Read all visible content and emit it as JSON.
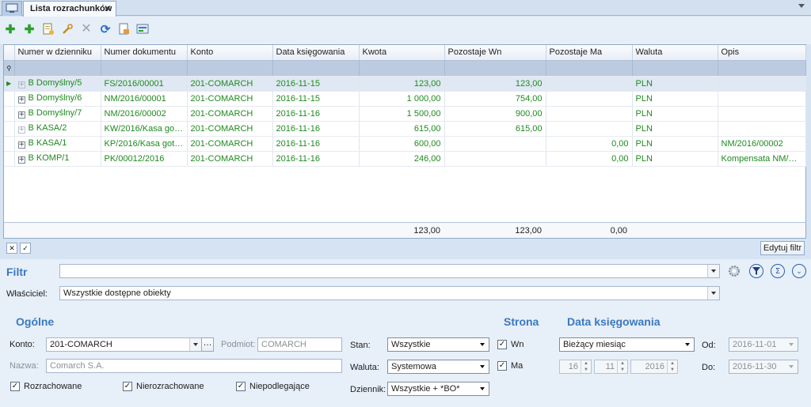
{
  "tabs": {
    "active_label": "Lista rozrachunków",
    "close_glyph": "✕"
  },
  "toolbar": {
    "icons": [
      "add-icon",
      "add-copy-icon",
      "add-document-icon",
      "edit-icon",
      "delete-icon",
      "refresh-icon",
      "export-icon",
      "settle-icon"
    ]
  },
  "grid": {
    "columns": [
      "Numer w dzienniku",
      "Numer dokumentu",
      "Konto",
      "Data księgowania",
      "Kwota",
      "Pozostaje Wn",
      "Pozostaje Ma",
      "Waluta",
      "Opis"
    ],
    "rows": [
      {
        "nr": "B Domyślny/5",
        "dok": "FS/2016/00001",
        "konto": "201-COMARCH",
        "data": "2016-11-15",
        "kwota": "123,00",
        "wn": "123,00",
        "ma": "",
        "waluta": "PLN",
        "opis": ""
      },
      {
        "nr": "B Domyślny/6",
        "dok": "NM/2016/00001",
        "konto": "201-COMARCH",
        "data": "2016-11-15",
        "kwota": "1 000,00",
        "wn": "754,00",
        "ma": "",
        "waluta": "PLN",
        "opis": ""
      },
      {
        "nr": "B Domyślny/7",
        "dok": "NM/2016/00002",
        "konto": "201-COMARCH",
        "data": "2016-11-16",
        "kwota": "1 500,00",
        "wn": "900,00",
        "ma": "",
        "waluta": "PLN",
        "opis": ""
      },
      {
        "nr": "B KASA/2",
        "dok": "KW/2016/Kasa gotó...",
        "konto": "201-COMARCH",
        "data": "2016-11-16",
        "kwota": "615,00",
        "wn": "615,00",
        "ma": "",
        "waluta": "PLN",
        "opis": ""
      },
      {
        "nr": "B KASA/1",
        "dok": "KP/2016/Kasa gotów...",
        "konto": "201-COMARCH",
        "data": "2016-11-16",
        "kwota": "600,00",
        "wn": "",
        "ma": "0,00",
        "waluta": "PLN",
        "opis": "NM/2016/00002"
      },
      {
        "nr": "B KOMP/1",
        "dok": "PK/00012/2016",
        "konto": "201-COMARCH",
        "data": "2016-11-16",
        "kwota": "246,00",
        "wn": "",
        "ma": "0,00",
        "waluta": "PLN",
        "opis": "Kompensata NM/201..."
      }
    ],
    "totals": {
      "kwota": "123,00",
      "wn": "123,00",
      "ma": "0,00"
    }
  },
  "bottom_bar": {
    "edit_filter_label": "Edytuj filtr"
  },
  "filter": {
    "title": "Filtr",
    "value": "",
    "owner_label": "Właściciel:",
    "owner_value": "Wszystkie dostępne obiekty"
  },
  "general": {
    "title": "Ogólne",
    "konto_label": "Konto:",
    "konto_value": "201-COMARCH",
    "podmiot_label": "Podmiot:",
    "podmiot_value": "COMARCH",
    "nazwa_label": "Nazwa:",
    "nazwa_value": "Comarch S.A.",
    "rozrachowane_label": "Rozrachowane",
    "nierozrachowane_label": "Nierozrachowane",
    "niepodlegajace_label": "Niepodlegające",
    "stan_label": "Stan:",
    "stan_value": "Wszystkie",
    "waluta_label": "Waluta:",
    "waluta_value": "Systemowa",
    "dziennik_label": "Dziennik:",
    "dziennik_value": "Wszystkie + *BO*"
  },
  "strona": {
    "title": "Strona",
    "wn_label": "Wn",
    "ma_label": "Ma"
  },
  "data_ksiegowania": {
    "title": "Data księgowania",
    "period_value": "Bieżący miesiąc",
    "day": "16",
    "month": "11",
    "year": "2016",
    "od_label": "Od:",
    "od_value": "2016-11-01",
    "do_label": "Do:",
    "do_value": "2016-11-30"
  }
}
